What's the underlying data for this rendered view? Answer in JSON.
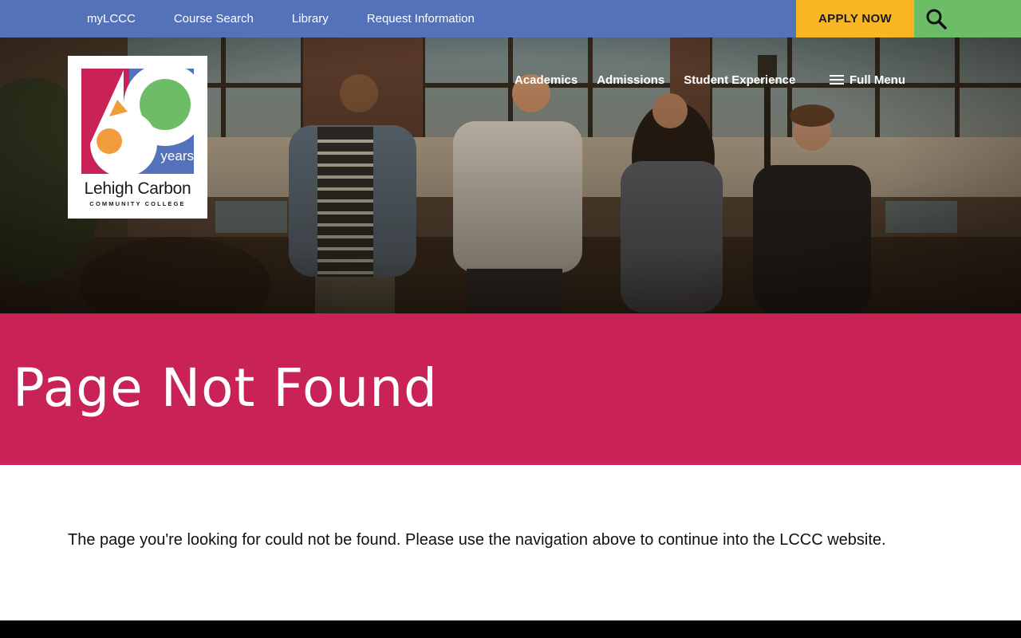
{
  "topbar": {
    "links": [
      "myLCCC",
      "Course Search",
      "Library",
      "Request Information"
    ],
    "apply_label": "APPLY NOW",
    "search_icon": "search-icon"
  },
  "logo": {
    "years_label": "years",
    "name_line1": "Lehigh Carbon",
    "name_line2": "COMMUNITY COLLEGE"
  },
  "nav": {
    "items": [
      "Academics",
      "Admissions",
      "Student Experience"
    ],
    "full_menu_label": "Full Menu",
    "full_menu_icon": "hamburger-icon"
  },
  "page": {
    "title": "Page Not Found",
    "message": "The page you're looking for could not be found. Please use the navigation above to continue into the LCCC website."
  },
  "colors": {
    "topbar": "#5372b9",
    "apply": "#f9b523",
    "search": "#6dbd66",
    "title_band": "#c82256"
  }
}
